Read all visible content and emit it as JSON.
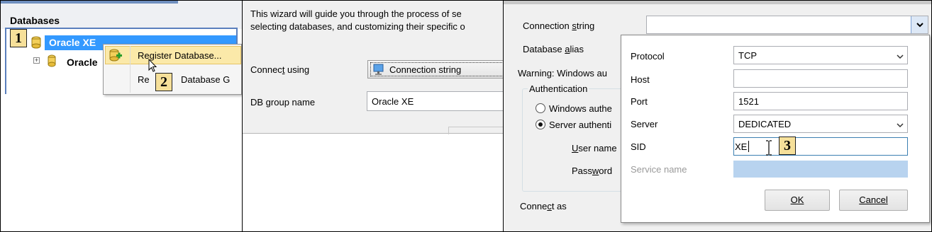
{
  "panel1": {
    "header_title": "Databases",
    "tree_selected": "Oracle XE",
    "tree_second": "Oracle",
    "menu": {
      "register_label": "Register Database...",
      "rename_label_start": "Re",
      "rename_label_end": "Database G"
    },
    "badges": [
      "1",
      "2"
    ]
  },
  "panel2": {
    "intro_line1": "This wizard will guide you through the process of se",
    "intro_line2": "selecting databases, and customizing their specific o",
    "connect_using_label": "Connect using",
    "connect_using_value": "Connection string",
    "db_group_label": "DB group name",
    "db_group_value": "Oracle XE"
  },
  "panel3": {
    "connection_string_label": "Connection string",
    "connection_string_value": "",
    "database_alias_label": "Database alias",
    "warning_text": "Warning: Windows au",
    "authentication_label": "Authentication",
    "windows_auth_label": "Windows authe",
    "server_auth_label": "Server authenti",
    "user_name_label": "User name",
    "password_label": "Password",
    "connect_as_label": "Connect as",
    "popup": {
      "protocol_label": "Protocol",
      "protocol_value": "TCP",
      "host_label": "Host",
      "host_value": "",
      "port_label": "Port",
      "port_value": "1521",
      "server_label": "Server",
      "server_value": "DEDICATED",
      "sid_label": "SID",
      "sid_value": "XE",
      "service_name_label": "Service name",
      "service_name_value": "",
      "ok_label": "OK",
      "cancel_label": "Cancel"
    },
    "badge": "3"
  },
  "colors": {
    "selection": "#3399ff",
    "menu_hover": "#fbe9a9",
    "disabled_field": "#b8d3ef",
    "badge_fill": "#f6e09a"
  }
}
